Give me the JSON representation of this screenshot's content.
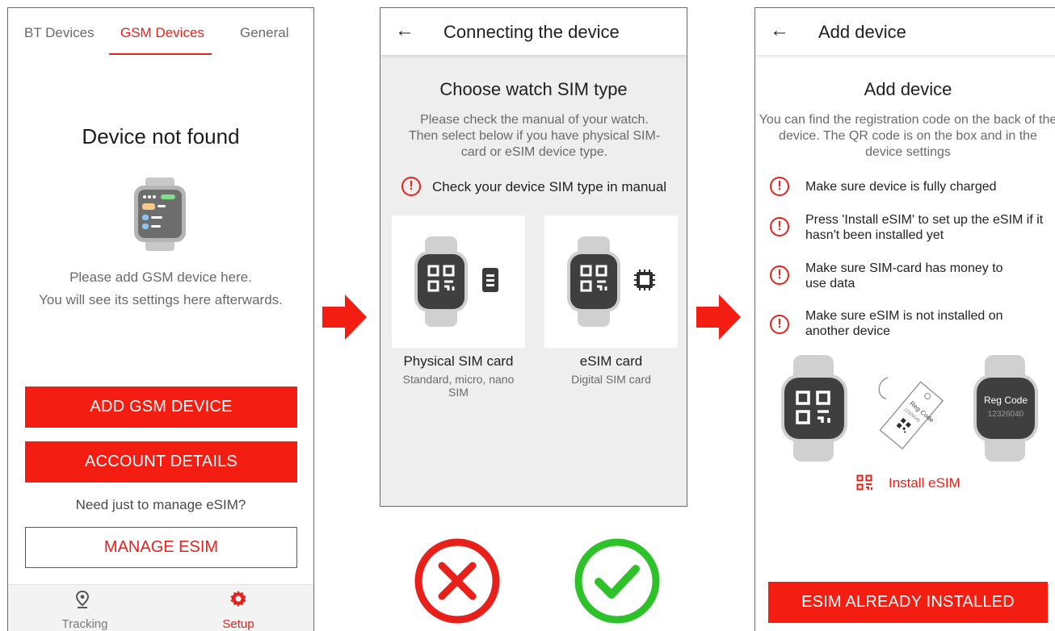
{
  "panel1": {
    "tabs": [
      "BT Devices",
      "GSM Devices",
      "General"
    ],
    "active_tab": "GSM Devices",
    "heading": "Device not found",
    "description_line1": "Please add GSM device here.",
    "description_line2": "You will see its settings here afterwards.",
    "add_button": "ADD GSM DEVICE",
    "account_button": "ACCOUNT DETAILS",
    "manage_prompt": "Need just to manage eSIM?",
    "manage_button": "MANAGE ESIM",
    "nav": {
      "tracking": "Tracking",
      "setup": "Setup"
    }
  },
  "panel2": {
    "title": "Connecting the device",
    "heading": "Choose watch SIM type",
    "description": "Please check the manual of your watch. Then select below if you have physical SIM-card or eSIM device type.",
    "warning": "Check your device SIM type in manual",
    "options": [
      {
        "title": "Physical SIM card",
        "subtitle": "Standard, micro, nano SIM"
      },
      {
        "title": "eSIM card",
        "subtitle": "Digital SIM card"
      }
    ]
  },
  "panel3": {
    "title": "Add device",
    "heading": "Add device",
    "description": "You can find the registration code on the back of the device. The QR code is on the box and in the device settings",
    "checks": [
      "Make sure device is fully charged",
      "Press 'Install eSIM' to set up the eSIM if it hasn't been installed yet",
      "Make sure SIM-card has money to use data",
      "Make sure eSIM is not installed on another device"
    ],
    "tag_label": "Reg Code",
    "tag_number": "12326040",
    "reg_code_label": "Reg Code",
    "reg_code_value": "12326040",
    "install_link": "Install eSIM",
    "installed_button": "ESIM ALREADY INSTALLED"
  },
  "colors": {
    "accent": "#e8201a",
    "button_red": "#f41d12",
    "wrong": "#e8201a",
    "right": "#2ec22a"
  }
}
